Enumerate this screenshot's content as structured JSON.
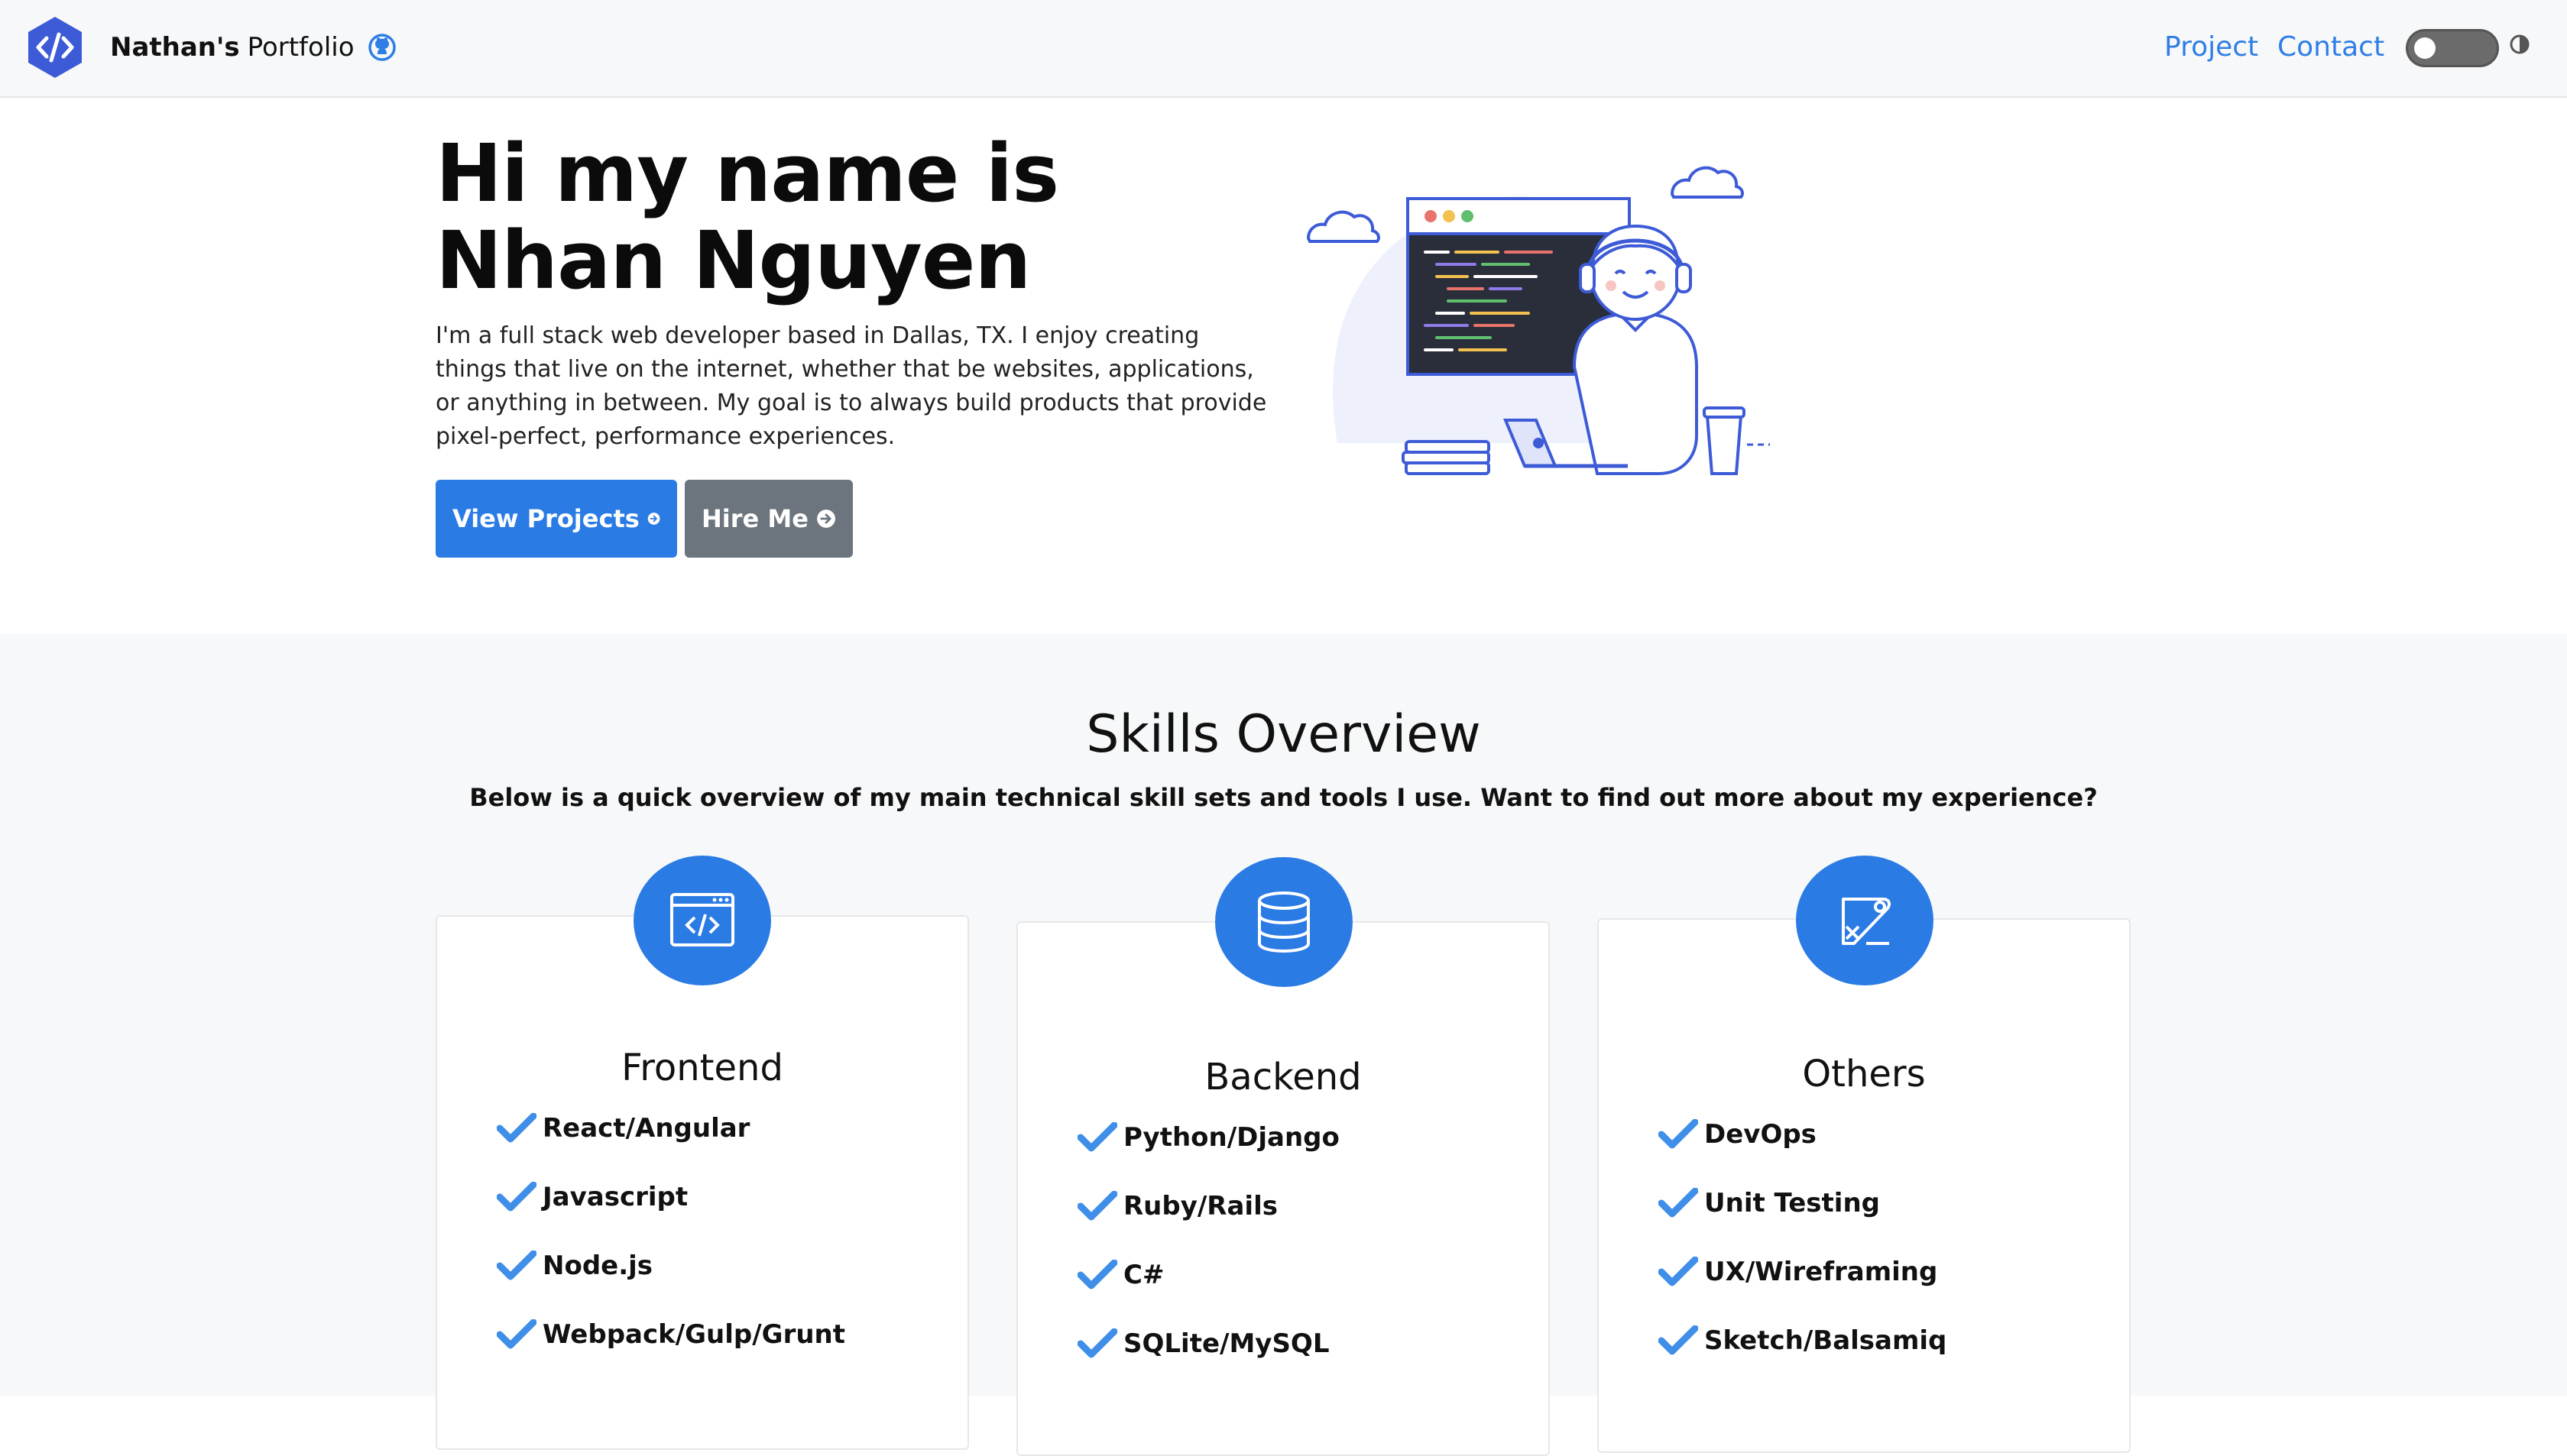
{
  "navbar": {
    "brand_bold": "Nathan's",
    "brand_rest": "Portfolio",
    "links": [
      "Project",
      "Contact"
    ],
    "logo_icon": "code-brackets-icon",
    "github_icon": "github-icon",
    "theme_toggle_icon": "contrast-icon",
    "accent_color": "#2f7ee6"
  },
  "hero": {
    "title": "Hi my name is Nhan Nguyen",
    "description": "I'm a full stack web developer based in Dallas, TX. I enjoy creating things that live on the internet, whether that be websites, applications, or anything in between. My goal is to always build products that provide pixel-perfect, performance experiences.",
    "primary_button": "View Projects",
    "secondary_button": "Hire Me",
    "button_icon": "arrow-circle-right-icon",
    "illustration": "developer-at-desk-illustration"
  },
  "skills": {
    "title": "Skills Overview",
    "subtitle": "Below is a quick overview of my main technical skill sets and tools I use. Want to find out more about my experience?",
    "cards": [
      {
        "title": "Frontend",
        "icon": "browser-code-icon",
        "items": [
          "React/Angular",
          "Javascript",
          "Node.js",
          "Webpack/Gulp/Grunt"
        ]
      },
      {
        "title": "Backend",
        "icon": "database-icon",
        "items": [
          "Python/Django",
          "Ruby/Rails",
          "C#",
          "SQLite/MySQL"
        ]
      },
      {
        "title": "Others",
        "icon": "design-tools-icon",
        "items": [
          "DevOps",
          "Unit Testing",
          "UX/Wireframing",
          "Sketch/Balsamiq"
        ]
      }
    ]
  }
}
